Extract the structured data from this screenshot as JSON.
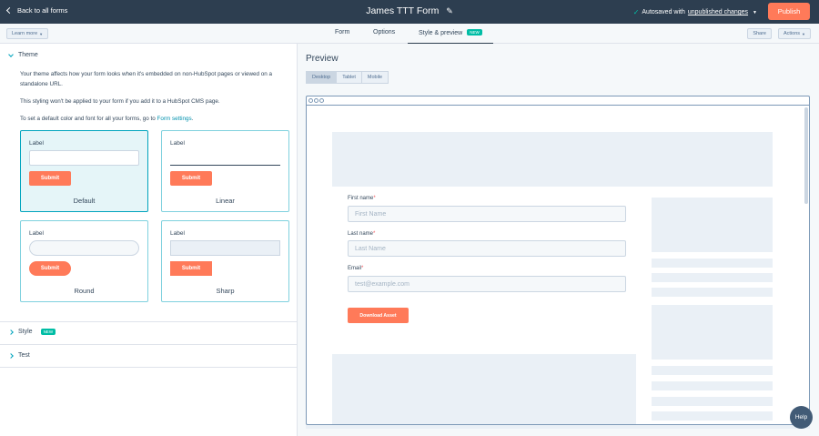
{
  "topbar": {
    "back_label": "Back to all forms",
    "form_title": "James TTT Form",
    "autosave_prefix": "Autosaved with",
    "autosave_link": "unpublished changes",
    "publish_label": "Publish"
  },
  "tabbar": {
    "learn_more": "Learn more",
    "tabs": [
      {
        "label": "Form"
      },
      {
        "label": "Options"
      },
      {
        "label": "Style & preview",
        "badge": "NEW"
      }
    ],
    "share": "Share",
    "actions": "Actions"
  },
  "left": {
    "theme_heading": "Theme",
    "para1": "Your theme affects how your form looks when it's embedded on non-HubSpot pages or viewed on a standalone URL.",
    "para2": "This styling won't be applied to your form if you add it to a HubSpot CMS page.",
    "para3_prefix": "To set a default color and font for all your forms, go to",
    "para3_link": "Form settings",
    "para3_suffix": ".",
    "themes": [
      {
        "name": "Default",
        "label": "Label",
        "button": "Submit"
      },
      {
        "name": "Linear",
        "label": "Label",
        "button": "Submit"
      },
      {
        "name": "Round",
        "label": "Label",
        "button": "Submit"
      },
      {
        "name": "Sharp",
        "label": "Label",
        "button": "Submit"
      }
    ],
    "style_heading": "Style",
    "style_badge": "NEW",
    "test_heading": "Test"
  },
  "right": {
    "preview_title": "Preview",
    "device_tabs": [
      "Desktop",
      "Tablet",
      "Mobile"
    ],
    "fields": [
      {
        "label": "First name",
        "required": "*",
        "placeholder": "First Name"
      },
      {
        "label": "Last name",
        "required": "*",
        "placeholder": "Last Name"
      },
      {
        "label": "Email",
        "required": "*",
        "placeholder": "test@example.com"
      }
    ],
    "submit_label": "Download Asset"
  },
  "help_label": "Help",
  "colors": {
    "topbar": "#2d3e50",
    "accent_orange": "#ff7a59",
    "teal": "#00bda5",
    "link": "#0091ae"
  }
}
